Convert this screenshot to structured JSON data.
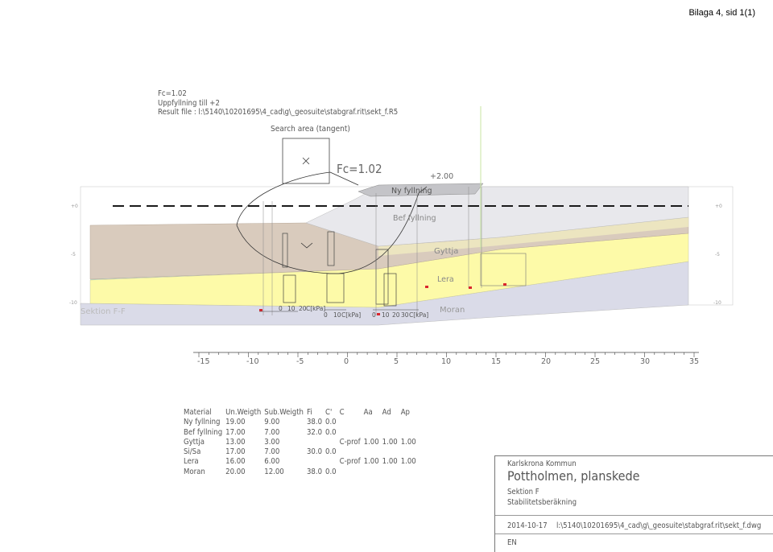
{
  "header": {
    "label": "Bilaga 4, sid 1(1)"
  },
  "analysis": {
    "fc_line": "Fc=1.02",
    "fill_line": "Uppfyllning till +2",
    "result_file_line": "Result file : l:\\5140\\10201695\\4_cad\\g\\_geosuite\\stabgraf.rit\\sekt_f.R5"
  },
  "diagram": {
    "search_area_label": "Search area (tangent)",
    "fc_label": "Fc=1.02",
    "level_label": "+2.00",
    "section_label": "Sektion F-F",
    "layer_labels": {
      "ny_fyllning": "Ny fyllning",
      "bef_fyllning": "Bef fyllning",
      "gyttja": "Gyttja",
      "lera": "Lera",
      "moran": "Moran"
    },
    "shear_axis_1": {
      "ticks": [
        "0",
        "10",
        "20"
      ],
      "unit": "C[kPa]"
    },
    "shear_axis_2": {
      "ticks": [
        "0",
        "10"
      ],
      "unit": "C[kPa]"
    },
    "shear_axis_3": {
      "ticks": [
        "0",
        "10",
        "20",
        "30"
      ],
      "unit": "C[kPa]"
    },
    "level_ticks": [
      "+0",
      "-5",
      "-10"
    ],
    "x_axis_ticks": [
      "-15",
      "-10",
      "-5",
      "0",
      "5",
      "10",
      "15",
      "20",
      "25",
      "30",
      "35"
    ],
    "colors": {
      "ny_fyllning": "#e8e8ec",
      "bef_fyllning": "#d9cbbd",
      "gyttja": "#f8f6c2",
      "lera": "#fdfaa8",
      "moran": "#dadbe8",
      "water_line": "#1a1a1a",
      "vertical_ref": "#c8e6a0",
      "marker": "#d9262e"
    }
  },
  "materials": {
    "headers": [
      "Material",
      "Un.Weigth",
      "Sub.Weigth",
      "Fi",
      "C'",
      "C",
      "Aa",
      "Ad",
      "Ap"
    ],
    "rows": [
      [
        "Ny fyllning",
        "19.00",
        "9.00",
        "38.0",
        "0.0",
        "",
        "",
        "",
        ""
      ],
      [
        "Bef fyllning",
        "17.00",
        "7.00",
        "32.0",
        "0.0",
        "",
        "",
        "",
        ""
      ],
      [
        "Gyttja",
        "13.00",
        "3.00",
        "",
        "",
        "C-prof",
        "1.00",
        "1.00",
        "1.00"
      ],
      [
        "Si/Sa",
        "17.00",
        "7.00",
        "30.0",
        "0.0",
        "",
        "",
        "",
        ""
      ],
      [
        "Lera",
        "16.00",
        "6.00",
        "",
        "",
        "C-prof",
        "1.00",
        "1.00",
        "1.00"
      ],
      [
        "Moran",
        "20.00",
        "12.00",
        "38.0",
        "0.0",
        "",
        "",
        "",
        ""
      ]
    ]
  },
  "title_block": {
    "client": "Karlskrona Kommun",
    "project": "Pottholmen, planskede",
    "section": "Sektion F",
    "calculation": "Stabilitetsberäkning",
    "date": "2014-10-17",
    "file": "l:\\5140\\10201695\\4_cad\\g\\_geosuite\\stabgraf.rit\\sekt_f.dwg",
    "drawn_by": "EN"
  }
}
